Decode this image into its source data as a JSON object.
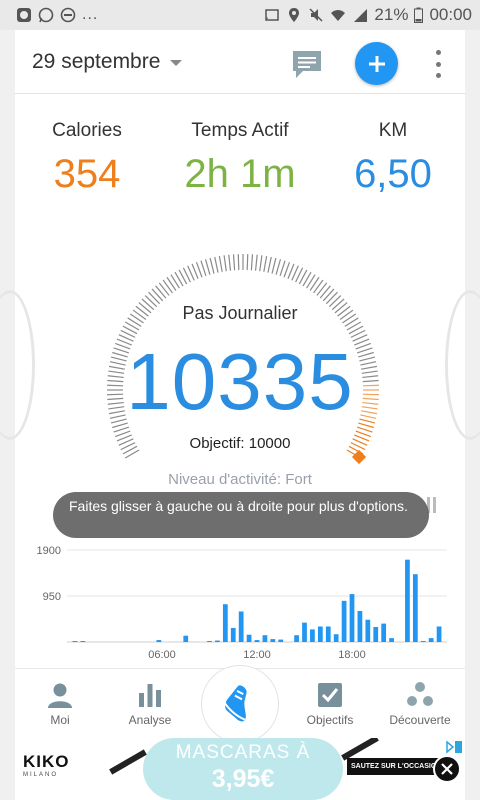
{
  "status_bar": {
    "battery": "21%",
    "time": "00:00",
    "overflow": "..."
  },
  "header": {
    "date": "29 septembre"
  },
  "stats": {
    "calories": {
      "label": "Calories",
      "value": "354",
      "color": "#ee7f1c"
    },
    "active_time": {
      "label": "Temps Actif",
      "value": "2h 1m",
      "color": "#7cb342"
    },
    "km": {
      "label": "KM",
      "value": "6,50",
      "color": "#2a8de0"
    }
  },
  "dial": {
    "title": "Pas Journalier",
    "steps": "10335",
    "goal": "Objectif: 10000",
    "activity_level": "Niveau d'activité: Fort",
    "goal_progress": 1.03
  },
  "toast": {
    "text": "Faites glisser à gauche ou à droite pour plus d'options."
  },
  "chart_data": {
    "type": "bar",
    "ylim": [
      0,
      1900
    ],
    "yticks": [
      "1900",
      "950"
    ],
    "xticks": [
      "06:00",
      "12:00",
      "18:00"
    ],
    "xlim_hours": [
      0,
      24
    ],
    "bar_color": "#2196f3",
    "x": [
      0.5,
      1.0,
      5.8,
      7.5,
      9.0,
      9.5,
      10.0,
      10.5,
      11.0,
      11.5,
      12.0,
      12.5,
      13.0,
      13.5,
      14.5,
      15.0,
      15.5,
      16.0,
      16.5,
      17.0,
      17.5,
      18.0,
      18.5,
      19.0,
      19.5,
      20.0,
      20.5,
      21.5,
      22.0,
      22.5,
      23.0,
      23.5
    ],
    "values": [
      20,
      20,
      40,
      130,
      20,
      30,
      780,
      290,
      630,
      150,
      40,
      140,
      60,
      50,
      140,
      400,
      260,
      320,
      320,
      160,
      850,
      990,
      640,
      460,
      310,
      380,
      80,
      1700,
      1400,
      20,
      80,
      320
    ]
  },
  "bottom_nav": {
    "items": [
      {
        "label": "Moi",
        "icon": "person-icon"
      },
      {
        "label": "Analyse",
        "icon": "bar-chart-icon"
      },
      {
        "label": "",
        "icon": "shoe-icon"
      },
      {
        "label": "Objectifs",
        "icon": "checkbox-icon"
      },
      {
        "label": "Découverte",
        "icon": "recycle-icon"
      }
    ]
  },
  "ad": {
    "brand": "KIKO",
    "brand_sub": "MILANO",
    "line1": "MASCARAS À",
    "line2": "3,95€",
    "cta": "SAUTEZ SUR L'OCCASION"
  }
}
